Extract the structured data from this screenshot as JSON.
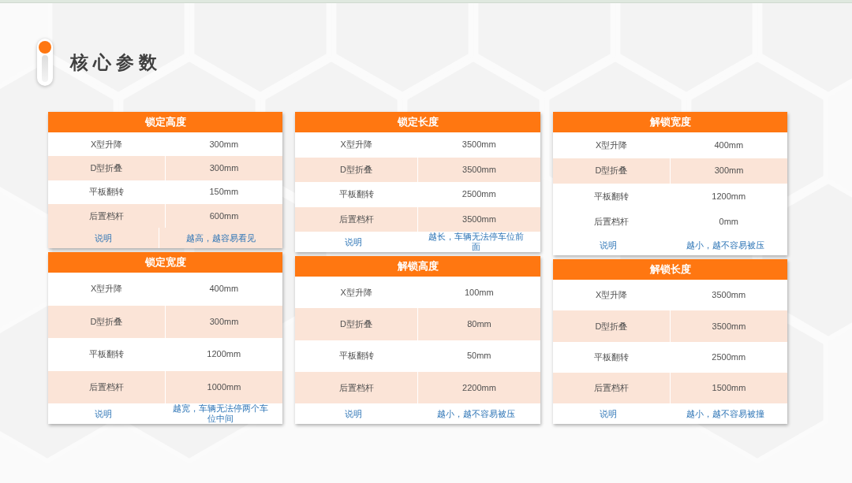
{
  "title": "核心参数",
  "columns": [
    {
      "tables": [
        {
          "title": "锁定高度",
          "rows": [
            {
              "label": "X型升降",
              "value": "300mm",
              "shaded": false
            },
            {
              "label": "D型折叠",
              "value": "300mm",
              "shaded": true
            },
            {
              "label": "平板翻转",
              "value": "150mm",
              "shaded": false
            },
            {
              "label": "后置档杆",
              "value": "600mm",
              "shaded": true
            }
          ],
          "note": {
            "label": "说明",
            "text": "越高，越容易看见",
            "shaded": true
          }
        },
        {
          "title": "锁定宽度",
          "rows": [
            {
              "label": "X型升降",
              "value": "400mm",
              "shaded": false
            },
            {
              "label": "D型折叠",
              "value": "300mm",
              "shaded": true
            },
            {
              "label": "平板翻转",
              "value": "1200mm",
              "shaded": false
            },
            {
              "label": "后置档杆",
              "value": "1000mm",
              "shaded": true
            }
          ],
          "note": {
            "label": "说明",
            "text": "越宽，车辆无法停两个车位中间",
            "shaded": false
          }
        }
      ]
    },
    {
      "tables": [
        {
          "title": "锁定长度",
          "rows": [
            {
              "label": "X型升降",
              "value": "3500mm",
              "shaded": false
            },
            {
              "label": "D型折叠",
              "value": "3500mm",
              "shaded": true
            },
            {
              "label": "平板翻转",
              "value": "2500mm",
              "shaded": false
            },
            {
              "label": "后置档杆",
              "value": "3500mm",
              "shaded": true
            }
          ],
          "note": {
            "label": "说明",
            "text": "越长，车辆无法停车位前面",
            "shaded": false
          }
        },
        {
          "title": "解锁高度",
          "rows": [
            {
              "label": "X型升降",
              "value": "100mm",
              "shaded": false
            },
            {
              "label": "D型折叠",
              "value": "80mm",
              "shaded": true
            },
            {
              "label": "平板翻转",
              "value": "50mm",
              "shaded": false
            },
            {
              "label": "后置档杆",
              "value": "2200mm",
              "shaded": true
            }
          ],
          "note": {
            "label": "说明",
            "text": "越小，越不容易被压",
            "shaded": false
          }
        }
      ]
    },
    {
      "tables": [
        {
          "title": "解锁宽度",
          "rows": [
            {
              "label": "X型升降",
              "value": "400mm",
              "shaded": false
            },
            {
              "label": "D型折叠",
              "value": "300mm",
              "shaded": true
            },
            {
              "label": "平板翻转",
              "value": "1200mm",
              "shaded": false
            },
            {
              "label": "后置档杆",
              "value": "0mm",
              "shaded": false
            }
          ],
          "note": {
            "label": "说明",
            "text": "越小，越不容易被压",
            "shaded": false
          }
        },
        {
          "title": "解锁长度",
          "rows": [
            {
              "label": "X型升降",
              "value": "3500mm",
              "shaded": false
            },
            {
              "label": "D型折叠",
              "value": "3500mm",
              "shaded": true
            },
            {
              "label": "平板翻转",
              "value": "2500mm",
              "shaded": false
            },
            {
              "label": "后置档杆",
              "value": "1500mm",
              "shaded": true
            }
          ],
          "note": {
            "label": "说明",
            "text": "越小，越不容易被撞",
            "shaded": false
          }
        }
      ]
    }
  ]
}
